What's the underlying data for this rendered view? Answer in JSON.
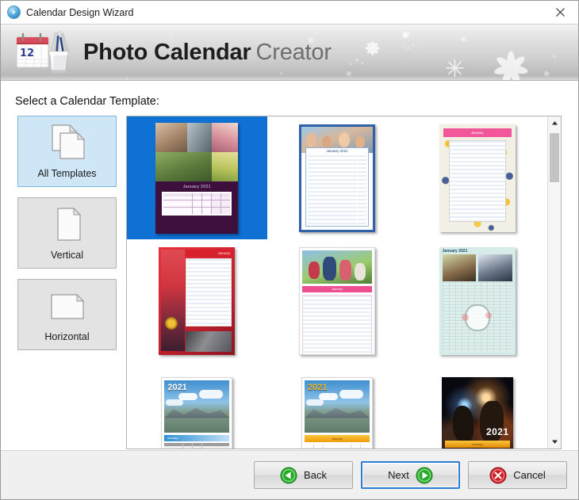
{
  "window": {
    "title": "Calendar Design Wizard",
    "app_icon": "compass-icon",
    "close_label": "×"
  },
  "banner": {
    "logo_icon": "calendar-brushes-icon",
    "title_bold": "Photo Calendar",
    "title_light": "Creator"
  },
  "main": {
    "section_label": "Select a Calendar Template:"
  },
  "sidebar": {
    "items": [
      {
        "label": "All Templates",
        "icon": "two-pages-icon",
        "selected": true
      },
      {
        "label": "Vertical",
        "icon": "portrait-page-icon",
        "selected": false
      },
      {
        "label": "Horizontal",
        "icon": "landscape-page-icon",
        "selected": false
      }
    ]
  },
  "templates": {
    "selected_index": 0,
    "items": [
      {
        "name": "photo-collage-purple",
        "selected": true
      },
      {
        "name": "blue-lined-january",
        "selected": false
      },
      {
        "name": "floral-pink-header",
        "selected": false
      },
      {
        "name": "red-january-lined",
        "selected": false
      },
      {
        "name": "pink-family-photo",
        "selected": false
      },
      {
        "name": "teal-two-portrait-january-2021",
        "selected": false
      },
      {
        "name": "mountain-2021-blue",
        "selected": false
      },
      {
        "name": "mountain-2021-orange",
        "selected": false
      },
      {
        "name": "nebula-2021-orange",
        "selected": false
      }
    ],
    "labels": {
      "january_2021": "January 2021",
      "january": "January",
      "year": "2021"
    }
  },
  "scrollbar": {
    "up_icon": "chevron-up-icon",
    "down_icon": "chevron-down-icon",
    "thumb": "scroll-thumb"
  },
  "footer": {
    "back_label": "Back",
    "next_label": "Next",
    "cancel_label": "Cancel",
    "next_focused": true
  },
  "colors": {
    "selection_blue": "#0f71d4",
    "sidebar_selected": "#cfe6f7",
    "focus_blue": "#2a7fd4",
    "green": "#35c23a",
    "red": "#d42a2a",
    "banner_gray": "#cfcfcf"
  }
}
